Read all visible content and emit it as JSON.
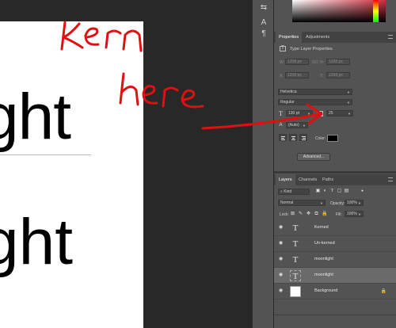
{
  "canvas": {
    "text_line_1": "ght",
    "text_line_2": "ght"
  },
  "annotation": {
    "word_1": "kern",
    "word_2": "here",
    "color": "#e01010"
  },
  "properties_panel": {
    "tabs": [
      "Properties",
      "Adjustments"
    ],
    "active_tab": "Properties",
    "header": "Type Layer Properties",
    "transform": {
      "w_label": "W:",
      "w_value": "1208 px",
      "go_label": "GO",
      "h_label": "H:",
      "h_value": "1208 px",
      "x_label": "X:",
      "x_value": "1208 px",
      "y_label": "Y:",
      "y_value": "1208 px"
    },
    "font_family": "Helvetica",
    "font_style": "Regular",
    "font_size": "130 pt",
    "tracking": "25",
    "leading": "(Auto)",
    "color_label": "Color:",
    "advanced_button": "Advanced..."
  },
  "layers_panel": {
    "tabs": [
      "Layers",
      "Channels",
      "Paths"
    ],
    "active_tab": "Layers",
    "search_placeholder": "Kind",
    "blend_mode": "Normal",
    "opacity_label": "Opacity:",
    "opacity_value": "100%",
    "lock_label": "Lock:",
    "fill_label": "Fill:",
    "fill_value": "100%",
    "layers": [
      {
        "name": "Kerned",
        "type": "text",
        "selected": false
      },
      {
        "name": "Un-kerned",
        "type": "text",
        "selected": false
      },
      {
        "name": "moonlight",
        "type": "text",
        "selected": false
      },
      {
        "name": "moonlight",
        "type": "text",
        "selected": true
      },
      {
        "name": "Background",
        "type": "image",
        "selected": false,
        "locked": true
      }
    ]
  },
  "icons": {
    "eye": "eye-icon",
    "text_layer": "T",
    "lock": "lock-icon"
  }
}
